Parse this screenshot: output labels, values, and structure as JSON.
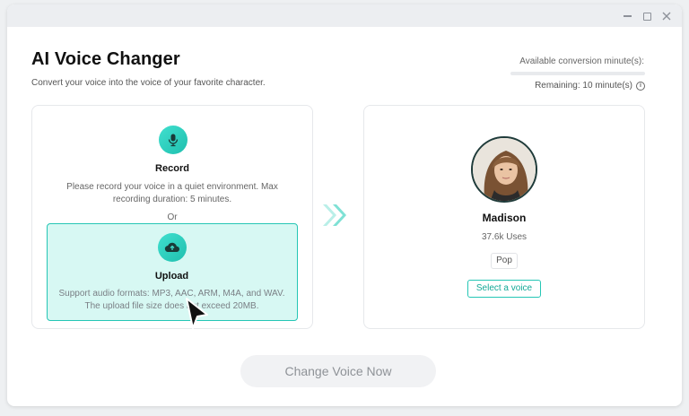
{
  "window": {
    "controls": [
      "minimize-icon",
      "maximize-icon",
      "close-icon"
    ]
  },
  "header": {
    "title": "AI Voice Changer",
    "subtitle": "Convert your voice into the voice of your favorite character."
  },
  "minutes": {
    "label": "Available conversion minute(s):",
    "remaining": "Remaining: 10 minute(s)",
    "used_fraction": 0,
    "info_icon": "info-icon"
  },
  "record": {
    "icon": "microphone-icon",
    "title": "Record",
    "description": "Please record your voice in a quiet environment. Max recording duration: 5 minutes."
  },
  "or_label": "Or",
  "upload": {
    "icon": "cloud-upload-icon",
    "title": "Upload",
    "description": "Support audio formats: MP3, AAC, ARM, M4A, and WAV. The upload file size does not exceed 20MB."
  },
  "voice": {
    "name": "Madison",
    "uses": "37.6k Uses",
    "genre": "Pop",
    "select_label": "Select a voice"
  },
  "action": {
    "change_label": "Change Voice Now"
  },
  "colors": {
    "accent": "#25c6b5",
    "accent_light": "#d7f8f3",
    "button_bg": "#f1f2f4"
  }
}
